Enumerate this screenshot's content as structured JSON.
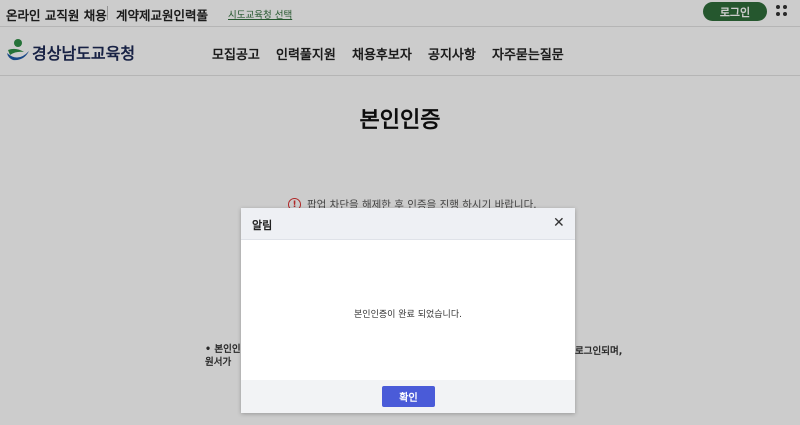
{
  "topbar": {
    "site_name": "온라인 교직원 채용",
    "service_name": "계약제교원인력풀",
    "region_link": "시도교육청 선택",
    "login_label": "로그인"
  },
  "header": {
    "logo_text": "경상남도교육청",
    "nav": [
      "모집공고",
      "인력풀지원",
      "채용후보자",
      "공지사항",
      "자주묻는질문"
    ]
  },
  "main": {
    "title": "본인인증",
    "warning": "팝업 차단을 해제한 후 인증을 진행 하시기 바랍니다.",
    "notice_left_line1": "• 본인인",
    "notice_left_line2": "원서가",
    "notice_right": "로그인되며,"
  },
  "modal": {
    "title": "알림",
    "message": "본인인증이 완료 되었습니다.",
    "confirm_label": "확인"
  },
  "colors": {
    "brand_green": "#2f6d3a",
    "confirm_blue": "#4a5bd8",
    "warning_red": "#d33333"
  }
}
